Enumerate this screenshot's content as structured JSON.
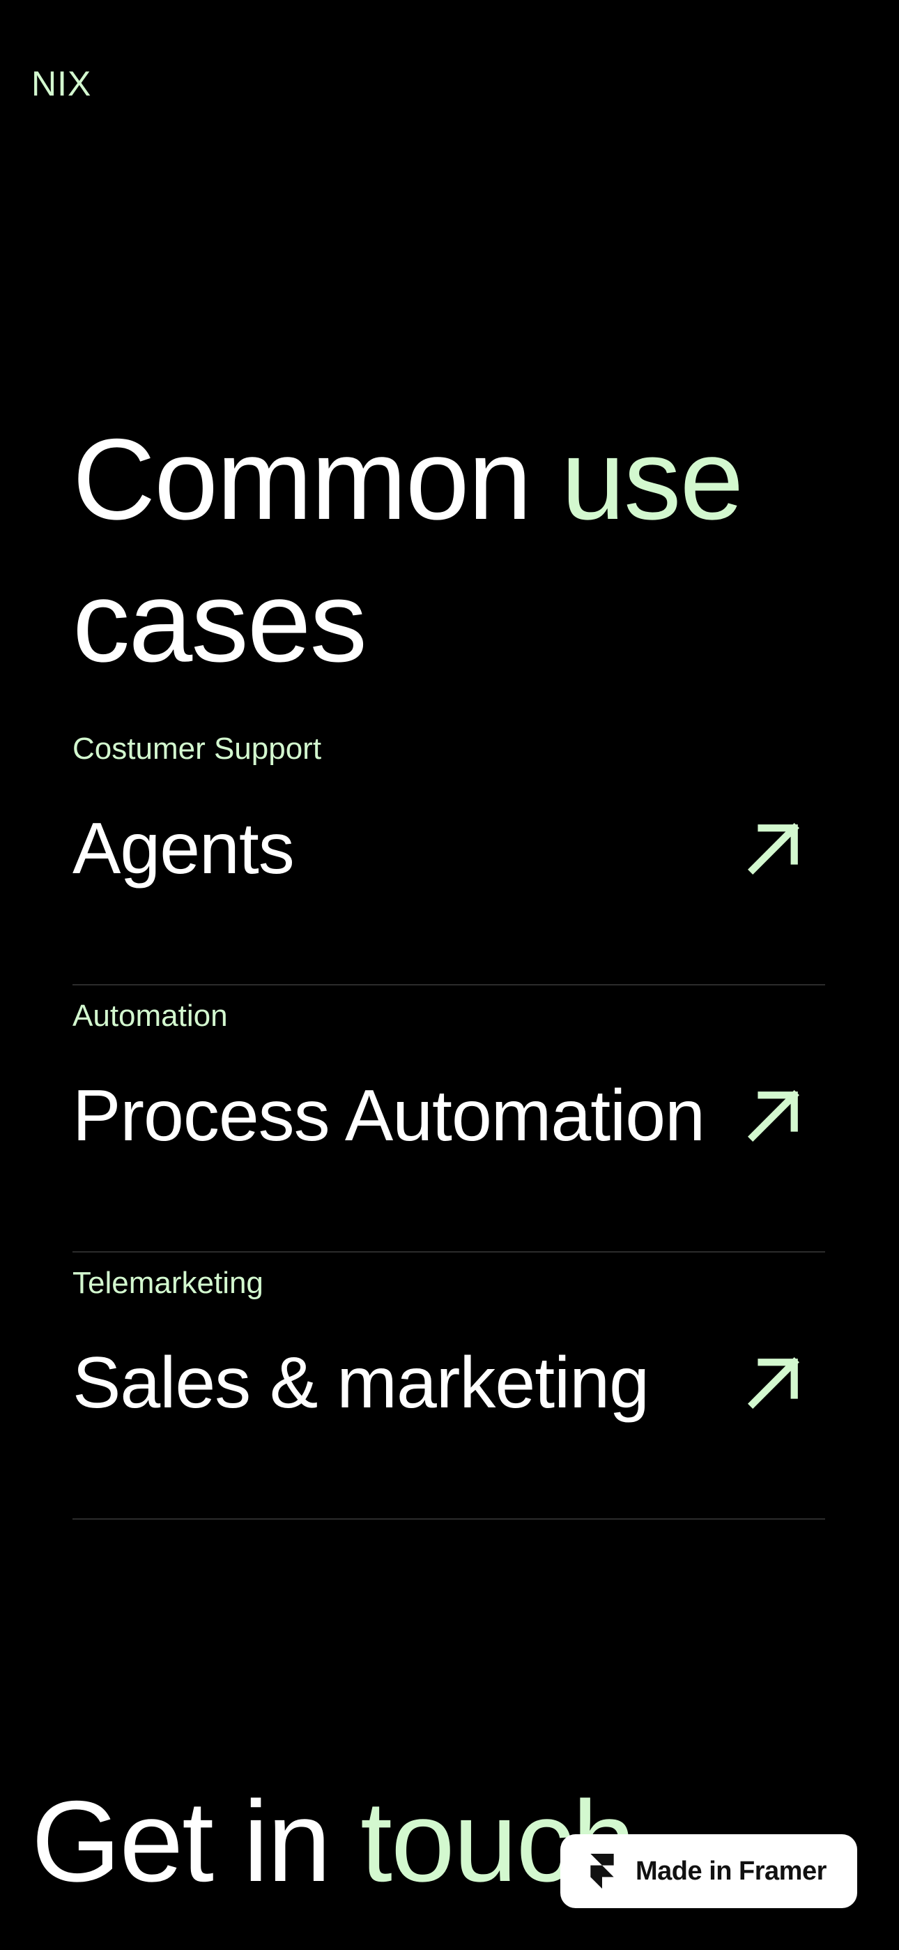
{
  "brand": {
    "logo": "NIX"
  },
  "headline": {
    "part1": "Common ",
    "accent": "use",
    "part2": "cases"
  },
  "cases": [
    {
      "category": "Costumer Support",
      "title": "Agents",
      "icon": "arrow-up-right-icon"
    },
    {
      "category": "Automation",
      "title": "Process Automation",
      "icon": "arrow-up-right-icon"
    },
    {
      "category": "Telemarketing",
      "title": "Sales & marketing",
      "icon": "arrow-up-right-icon"
    }
  ],
  "footer": {
    "part1": "Get in ",
    "accent": "touch"
  },
  "badge": {
    "label": "Made in Framer",
    "icon": "framer-logo-icon"
  },
  "colors": {
    "background": "#000000",
    "accent": "#d3f8cf",
    "text": "#ffffff",
    "divider": "#2c2c2c"
  }
}
